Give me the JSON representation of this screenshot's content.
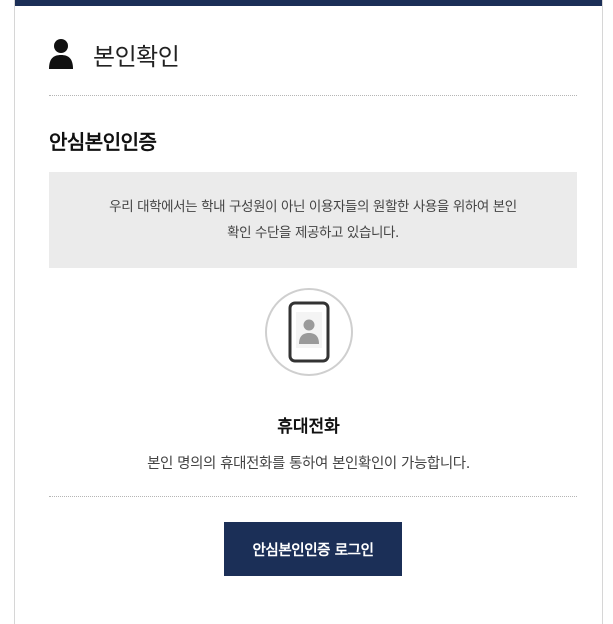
{
  "header": {
    "icon": "user-icon",
    "title": "본인확인"
  },
  "section": {
    "title": "안심본인인증"
  },
  "notice": {
    "line1": "우리 대학에서는 학내 구성원이 아닌 이용자들의 원할한 사용을 위하여 본인",
    "line2": "확인 수단을 제공하고 있습니다."
  },
  "method": {
    "icon": "mobile-phone-icon",
    "label": "휴대전화",
    "description": "본인 명의의 휴대전화를 통하여 본인확인이 가능합니다."
  },
  "login_button": {
    "label": "안심본인인증 로그인"
  },
  "colors": {
    "accent": "#1b2f57",
    "notice_bg": "#ebebeb"
  }
}
